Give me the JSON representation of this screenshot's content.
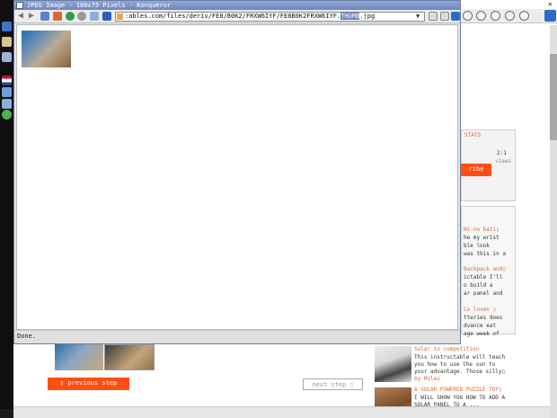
{
  "window": {
    "title": "JPEG Image - 100x75 Pixels - Konqueror",
    "url_prefix": ":ables.com/files/deriv/FE8/B0K2/FRXW6IYF/FE8B0K2FRXW6IYF.",
    "url_highlight": "THUMB",
    "url_suffix": ".jpg",
    "status": "Done."
  },
  "background": {
    "stats_heading": "STATS",
    "stats_value": "2:1",
    "stats_unit": "views",
    "subscribe_label": "ribe",
    "related": [
      "Ni-no bati▯",
      "he my wrist",
      "ble look",
      "was this in a",
      "Backpack and▯",
      "ictable I'll",
      "o build a",
      "ar panel and",
      "Co loven ▯",
      "tteries does",
      "dvance eat",
      "age week of"
    ],
    "solar_item_title": "Solar in competition",
    "solar_item_text": [
      "This instructable will teach",
      "you how to use the sun to",
      "your advantage. Those silly▯",
      "by Miles"
    ],
    "solar_toy_title": "A SOLAR POWERED PUZZLE TOY▯",
    "solar_toy_text": [
      "I WILL SHOW YOU HOW TO ADD A",
      "SOLAR PANEL TO A ..."
    ],
    "prev_step": "▯ previous step",
    "next_step": "next step ▯"
  },
  "colors": {
    "accent": "#ff4e12",
    "title_bar": "#7a8fc4"
  }
}
